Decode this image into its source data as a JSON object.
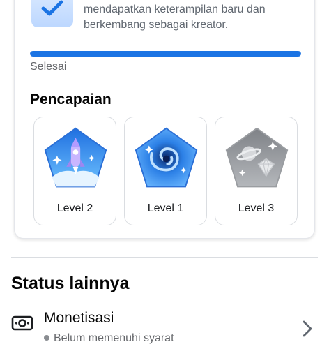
{
  "task": {
    "icon": "checkbox-icon",
    "text": "Selesaikan tugas minggu ini untuk mendapatkan keterampilan baru dan berkembang sebagai kreator."
  },
  "progress": {
    "label": "Selesai",
    "fraction": 1.0,
    "color": "#1b74e4"
  },
  "achievements": {
    "title": "Pencapaian",
    "badges": [
      {
        "label": "Level 2",
        "icon": "rocket-badge-icon"
      },
      {
        "label": "Level 1",
        "icon": "galaxy-badge-icon"
      },
      {
        "label": "Level 3",
        "icon": "planet-diamond-badge-icon"
      }
    ]
  },
  "other_status": {
    "title": "Status lainnya",
    "items": [
      {
        "icon": "money-icon",
        "title": "Monetisasi",
        "subtitle": "Belum memenuhi syarat"
      }
    ]
  }
}
